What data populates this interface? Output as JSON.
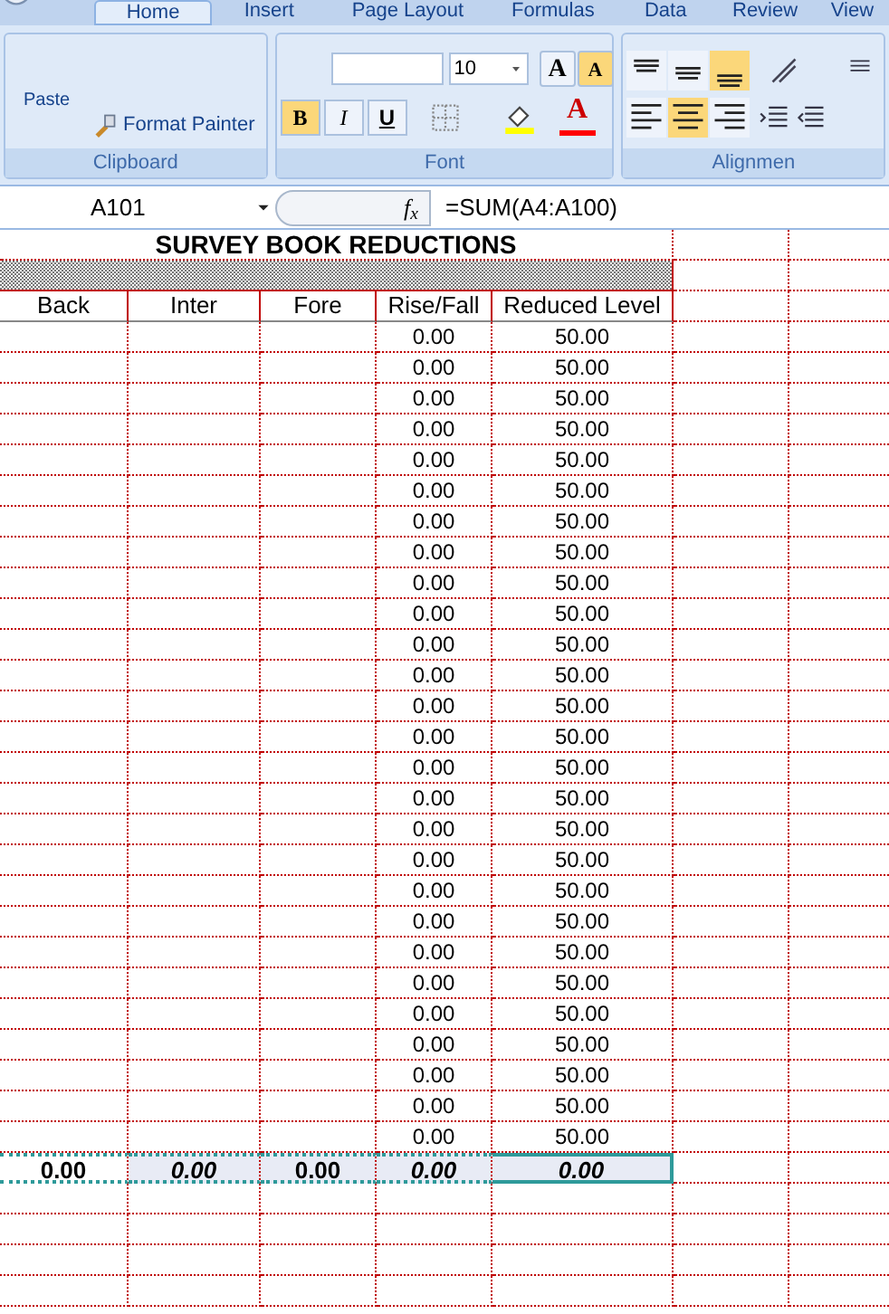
{
  "ribbon": {
    "tabs": [
      {
        "label": "Home",
        "selected": true
      },
      {
        "label": "Insert",
        "selected": false
      },
      {
        "label": "Page Layout",
        "selected": false
      },
      {
        "label": "Formulas",
        "selected": false
      },
      {
        "label": "Data",
        "selected": false
      },
      {
        "label": "Review",
        "selected": false
      },
      {
        "label": "View",
        "selected": false
      }
    ],
    "clipboard": {
      "label": "Clipboard",
      "paste": "Paste",
      "format_painter": "Format Painter"
    },
    "font": {
      "label": "Font",
      "size": "10",
      "grow": "A",
      "shrink": "A",
      "shrink_on": true,
      "styles": [
        {
          "label": "B",
          "on": true
        },
        {
          "label": "I",
          "on": false
        },
        {
          "label": "U",
          "on": false
        }
      ],
      "font_color": "A"
    },
    "alignment": {
      "label": "Alignmen",
      "vertical": [
        {
          "selected": false
        },
        {
          "selected": false
        },
        {
          "selected": true
        }
      ],
      "horizontal": [
        {
          "selected": false
        },
        {
          "selected": true
        },
        {
          "selected": false
        }
      ]
    }
  },
  "formula_bar": {
    "name_box": "A101",
    "function_label": "f$_{x}$",
    "formula": "=SUM(A4:A100)"
  },
  "sheet": {
    "title": "SURVEY BOOK REDUCTIONS",
    "columns": [
      "Back",
      "Inter",
      "Fore",
      "Rise/Fall",
      "Reduced Level"
    ],
    "rows": [
      {
        "rise_fall": "0.00",
        "reduced_level": "50.00"
      },
      {
        "rise_fall": "0.00",
        "reduced_level": "50.00"
      },
      {
        "rise_fall": "0.00",
        "reduced_level": "50.00"
      },
      {
        "rise_fall": "0.00",
        "reduced_level": "50.00"
      },
      {
        "rise_fall": "0.00",
        "reduced_level": "50.00"
      },
      {
        "rise_fall": "0.00",
        "reduced_level": "50.00"
      },
      {
        "rise_fall": "0.00",
        "reduced_level": "50.00"
      },
      {
        "rise_fall": "0.00",
        "reduced_level": "50.00"
      },
      {
        "rise_fall": "0.00",
        "reduced_level": "50.00"
      },
      {
        "rise_fall": "0.00",
        "reduced_level": "50.00"
      },
      {
        "rise_fall": "0.00",
        "reduced_level": "50.00"
      },
      {
        "rise_fall": "0.00",
        "reduced_level": "50.00"
      },
      {
        "rise_fall": "0.00",
        "reduced_level": "50.00"
      },
      {
        "rise_fall": "0.00",
        "reduced_level": "50.00"
      },
      {
        "rise_fall": "0.00",
        "reduced_level": "50.00"
      },
      {
        "rise_fall": "0.00",
        "reduced_level": "50.00"
      },
      {
        "rise_fall": "0.00",
        "reduced_level": "50.00"
      },
      {
        "rise_fall": "0.00",
        "reduced_level": "50.00"
      },
      {
        "rise_fall": "0.00",
        "reduced_level": "50.00"
      },
      {
        "rise_fall": "0.00",
        "reduced_level": "50.00"
      },
      {
        "rise_fall": "0.00",
        "reduced_level": "50.00"
      },
      {
        "rise_fall": "0.00",
        "reduced_level": "50.00"
      },
      {
        "rise_fall": "0.00",
        "reduced_level": "50.00"
      },
      {
        "rise_fall": "0.00",
        "reduced_level": "50.00"
      },
      {
        "rise_fall": "0.00",
        "reduced_level": "50.00"
      },
      {
        "rise_fall": "0.00",
        "reduced_level": "50.00"
      },
      {
        "rise_fall": "0.00",
        "reduced_level": "50.00"
      }
    ],
    "totals": [
      {
        "value": "0.00",
        "italic": false,
        "selected": false
      },
      {
        "value": "0.00",
        "italic": true,
        "selected": true
      },
      {
        "value": "0.00",
        "italic": false,
        "selected": true
      },
      {
        "value": "0.00",
        "italic": true,
        "selected": true
      },
      {
        "value": "0.00",
        "italic": true,
        "selected": true
      }
    ]
  }
}
